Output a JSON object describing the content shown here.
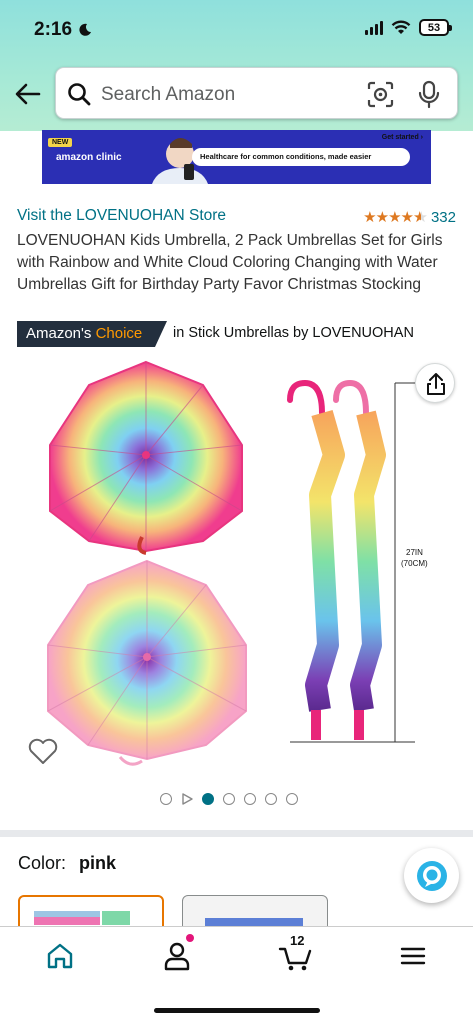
{
  "status_bar": {
    "time": "2:16",
    "battery": "53"
  },
  "search": {
    "placeholder": "Search Amazon"
  },
  "banner": {
    "badge": "NEW",
    "brand": "amazon clinic",
    "message": "Healthcare for common conditions, made easier",
    "cta": "Get started ›"
  },
  "product": {
    "store_link": "Visit the LOVENUOHAN Store",
    "rating_stars": 4.5,
    "rating_count": "332",
    "title": "LOVENUOHAN Kids Umbrella, 2 Pack Umbrellas Set for Girls with Rainbow and White Cloud Coloring Changing with Water Umbrellas Gift for Birthday Party Favor Christmas Stocking",
    "choice_prefix": "Amazon's",
    "choice_accent": "Choice",
    "choice_category": "in Stick Umbrellas by LOVENUOHAN",
    "dimension_label_1": "27IN",
    "dimension_label_2": "(70CM)"
  },
  "carousel": {
    "dot_count": 6,
    "active_index": 1
  },
  "variation": {
    "label": "Color:",
    "value": "pink"
  },
  "bottom_nav": {
    "cart_count": "12"
  },
  "colors": {
    "link": "#007185",
    "star": "#de7921",
    "accent": "#ff9900",
    "badge_bg": "#232f3e"
  }
}
